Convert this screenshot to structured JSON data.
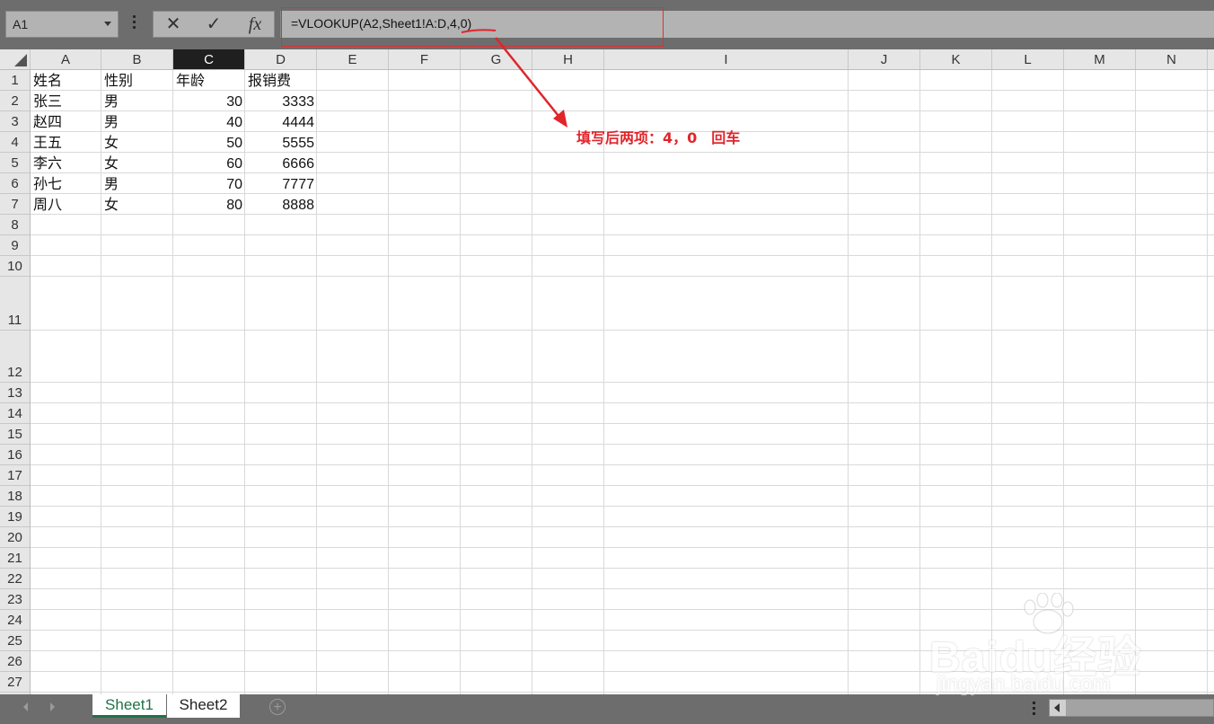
{
  "namebox": {
    "value": "A1"
  },
  "formula_buttons": {
    "cancel_label": "✕",
    "enter_label": "✓",
    "fx_label": "fx"
  },
  "formula_bar": {
    "value": "=VLOOKUP(A2,Sheet1!A:D,4,0)"
  },
  "columns": [
    "A",
    "B",
    "C",
    "D",
    "E",
    "F",
    "G",
    "H",
    "I",
    "J",
    "K",
    "L",
    "M",
    "N"
  ],
  "selected_column": "C",
  "rows": [
    "1",
    "2",
    "3",
    "4",
    "5",
    "6",
    "7",
    "8",
    "9",
    "10",
    "11",
    "12",
    "13",
    "14",
    "15",
    "16",
    "17",
    "18",
    "19",
    "20",
    "21",
    "22",
    "23",
    "24",
    "25",
    "26",
    "27"
  ],
  "table": {
    "headers": [
      "姓名",
      "性别",
      "年龄",
      "报销费"
    ],
    "rows": [
      [
        "张三",
        "男",
        "30",
        "3333"
      ],
      [
        "赵四",
        "男",
        "40",
        "4444"
      ],
      [
        "王五",
        "女",
        "50",
        "5555"
      ],
      [
        "李六",
        "女",
        "60",
        "6666"
      ],
      [
        "孙七",
        "男",
        "70",
        "7777"
      ],
      [
        "周八",
        "女",
        "80",
        "8888"
      ]
    ]
  },
  "annotation": {
    "text": "填写后两项：4，0　回车",
    "color": "#e0252b"
  },
  "sheet_tabs": [
    {
      "label": "Sheet1",
      "active": true
    },
    {
      "label": "Sheet2",
      "active": false
    }
  ],
  "add_sheet_label": "+",
  "watermark": {
    "main": "Baidu经验",
    "sub": "jingyan.baidu.com"
  },
  "colors": {
    "accent": "#217346",
    "selected_header": "#1f1f1f",
    "annotation": "#e0252b"
  }
}
